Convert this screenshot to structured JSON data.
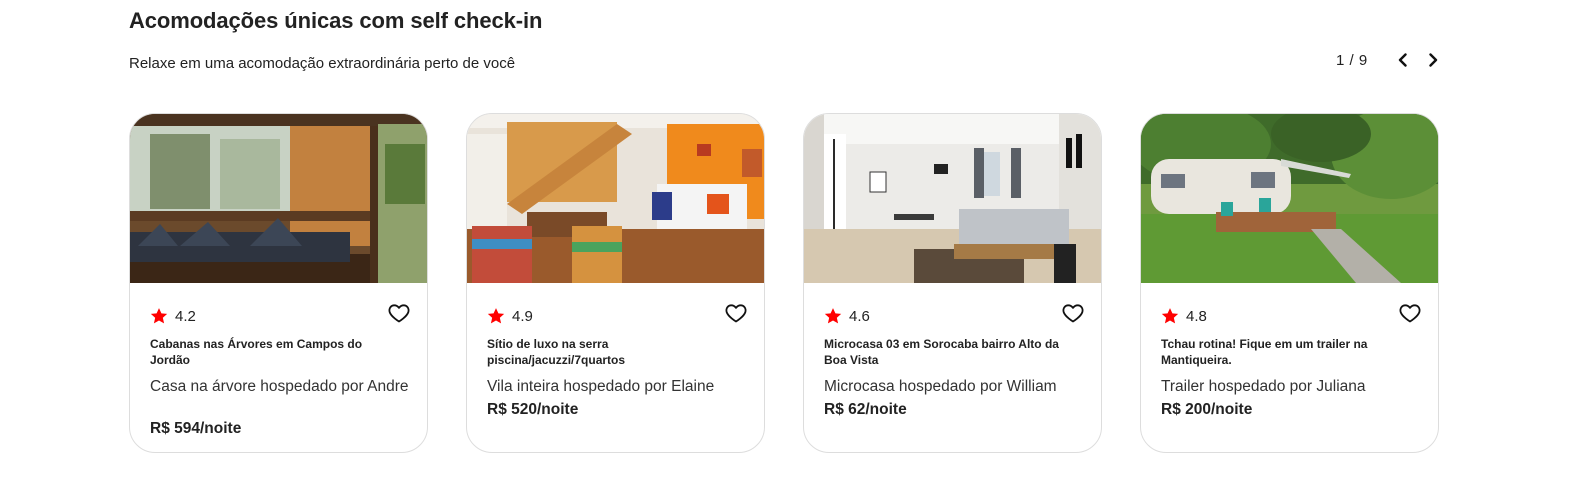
{
  "header": {
    "title": "Acomodações únicas com self check-in",
    "subtitle": "Relaxe em uma acomodação extraordinária perto de você"
  },
  "pager": {
    "count": "1 / 9",
    "prev_icon": "chevron-left-icon",
    "next_icon": "chevron-right-icon"
  },
  "colors": {
    "star": "#ff0000",
    "text": "#222222",
    "border": "#dddddd"
  },
  "listings": [
    {
      "rating": "4.2",
      "name": "Cabanas nas Árvores em Campos do Jordão",
      "type": "Casa na árvore hospedado por Andre",
      "price": "R$ 594/noite"
    },
    {
      "rating": "4.9",
      "name": "Sítio de luxo na serra piscina/jacuzzi/7quartos",
      "type": "Vila inteira hospedado por Elaine",
      "price": "R$ 520/noite"
    },
    {
      "rating": "4.6",
      "name": "Microcasa 03 em Sorocaba bairro Alto da Boa Vista",
      "type": "Microcasa hospedado por William",
      "price": "R$ 62/noite"
    },
    {
      "rating": "4.8",
      "name": "Tchau rotina! Fique em um trailer na Mantiqueira.",
      "type": "Trailer hospedado por Juliana",
      "price": "R$ 200/noite"
    }
  ]
}
